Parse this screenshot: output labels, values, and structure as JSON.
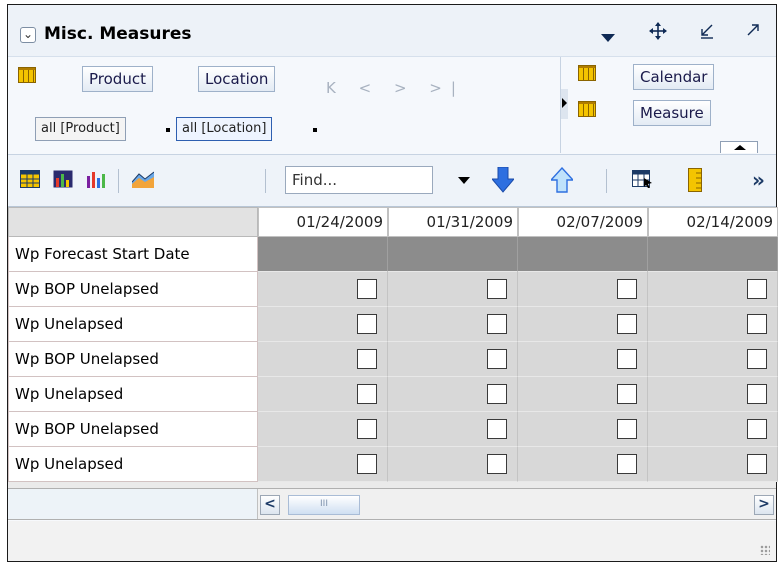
{
  "title_bar": {
    "title": "Misc. Measures",
    "icons": [
      "chevron-down-icon",
      "move-icon",
      "minimize-icon",
      "maximize-icon"
    ]
  },
  "dimensions": {
    "row_tiles": [
      "Product",
      "Location"
    ],
    "column_tiles": [
      "Calendar",
      "Measure"
    ],
    "nav_glyphs": "K < > >|",
    "selections": [
      "all [Product]",
      "all [Location]"
    ]
  },
  "toolbar": {
    "find_placeholder": "Find...",
    "icons": [
      "grid-view-icon",
      "chart-grid-icon",
      "bar-chart-icon",
      "area-chart-icon",
      "scroll-down-icon",
      "scroll-up-icon",
      "table-export-icon",
      "ruler-icon",
      "overflow-icon"
    ],
    "overflow_glyph": "»"
  },
  "table": {
    "columns": [
      "01/24/2009",
      "01/31/2009",
      "02/07/2009",
      "02/14/2009"
    ],
    "rows": [
      {
        "label": "Wp Forecast Start Date",
        "type": "date"
      },
      {
        "label": "Wp BOP Unelapsed",
        "type": "checkbox"
      },
      {
        "label": "Wp Unelapsed",
        "type": "checkbox"
      },
      {
        "label": "Wp BOP Unelapsed",
        "type": "checkbox"
      },
      {
        "label": "Wp Unelapsed",
        "type": "checkbox"
      },
      {
        "label": "Wp BOP Unelapsed",
        "type": "checkbox"
      },
      {
        "label": "Wp Unelapsed",
        "type": "checkbox"
      }
    ]
  },
  "scrollbar": {
    "left_glyph": "<",
    "right_glyph": ">",
    "thumb_glyph": "III"
  },
  "colors": {
    "header_bg": "#edf2f8",
    "cell_bg": "#d8d8d8",
    "locked_cell_bg": "#8c8c8c",
    "arrow_blue": "#2e6fe0"
  }
}
